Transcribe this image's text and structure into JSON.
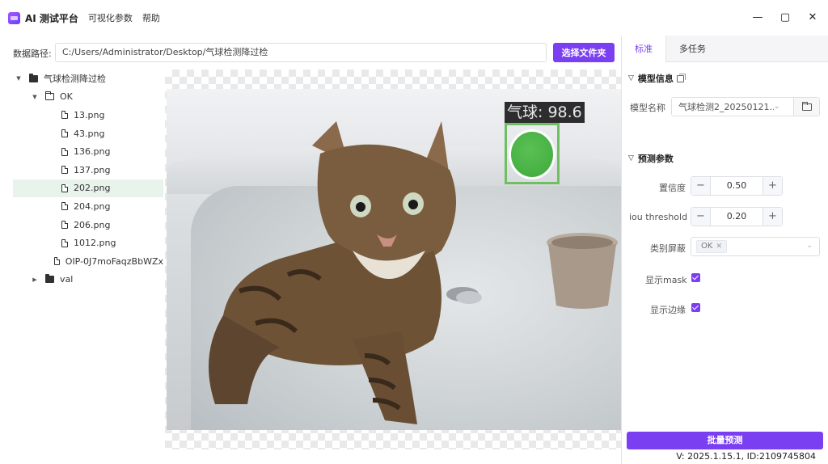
{
  "app": {
    "title": "AI 测试平台"
  },
  "menu": [
    "可视化参数",
    "帮助"
  ],
  "window_controls": {
    "minimize": "—",
    "maximize": "▢",
    "close": "✕"
  },
  "path_bar": {
    "label": "数据路径:",
    "value": "C:/Users/Administrator/Desktop/气球检测降过检",
    "button": "选择文件夹"
  },
  "tree": {
    "root": "气球检测降过检",
    "ok_folder": "OK",
    "files": [
      "13.png",
      "43.png",
      "136.png",
      "137.png",
      "202.png",
      "204.png",
      "206.png",
      "1012.png",
      "OIP-0J7moFaqzBbWZx"
    ],
    "selected_file": "202.png",
    "val_folder": "val"
  },
  "detection": {
    "label": "气球: 98.6",
    "color": "#6fbf62"
  },
  "right_panel": {
    "tabs": [
      "标准",
      "多任务"
    ],
    "active_tab": "标准",
    "model_section": {
      "title": "模型信息",
      "model_name_label": "模型名称",
      "model_name_value": "气球检测2_20250121..."
    },
    "predict_section": {
      "title": "预测参数",
      "confidence_label": "置信度",
      "confidence_value": "0.50",
      "iou_label": "iou threshold",
      "iou_value": "0.20",
      "class_mask_label": "类别屏蔽",
      "class_mask_tag": "OK",
      "show_mask_label": "显示mask",
      "show_mask_checked": true,
      "show_edge_label": "显示边缘",
      "show_edge_checked": true
    },
    "batch_button": "批量预测",
    "version": "V: 2025.1.15.1, ID:2109745804"
  },
  "colors": {
    "accent": "#7b3ff2",
    "selected_row": "#e8f3ec"
  },
  "icons": [
    "app-logo-icon",
    "folder-icon",
    "folder-open-icon",
    "file-icon",
    "caret-icon",
    "copy-icon",
    "chevron-down-icon",
    "folder-browse-icon"
  ]
}
